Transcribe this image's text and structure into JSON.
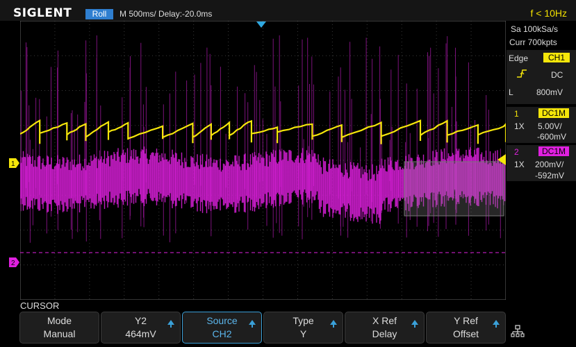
{
  "header": {
    "brand": "SIGLENT",
    "run_state": "Roll",
    "timebase": "M 500ms/  Delay:-20.0ms",
    "frequency": "f < 10Hz"
  },
  "acquisition": {
    "sample_rate": "Sa 100kSa/s",
    "memory": "Curr 700kpts"
  },
  "trigger": {
    "type": "Edge",
    "source": "CH1",
    "slope_icon": "rising-edge-icon",
    "coupling": "DC",
    "level_prefix": "L",
    "level": "800mV"
  },
  "channels": [
    {
      "number": "1",
      "coupling": "DC1M",
      "probe": "1X",
      "scale": "5.00V/",
      "offset": "-600mV",
      "color": "#f5e60a"
    },
    {
      "number": "2",
      "coupling": "DC1M",
      "probe": "1X",
      "scale": "200mV/",
      "offset": "-592mV",
      "color": "#e020e0"
    }
  ],
  "markers": {
    "ch1_marker": "1",
    "ch2_marker": "2"
  },
  "cursor_label": "CURSOR",
  "softkeys": [
    {
      "line1": "Mode",
      "line2": "Manual",
      "arrow": false,
      "active": false
    },
    {
      "line1": "Y2",
      "line2": "464mV",
      "arrow": true,
      "active": false
    },
    {
      "line1": "Source",
      "line2": "CH2",
      "arrow": true,
      "active": true
    },
    {
      "line1": "Type",
      "line2": "Y",
      "arrow": true,
      "active": false
    },
    {
      "line1": "X Ref",
      "line2": "Delay",
      "arrow": true,
      "active": false
    },
    {
      "line1": "Y Ref",
      "line2": "Offset",
      "arrow": true,
      "active": false
    }
  ],
  "colors": {
    "ch1": "#f5e60a",
    "ch2": "#e020e0",
    "accent": "#3aa0d8",
    "trigger_marker": "#2fa8e0"
  }
}
